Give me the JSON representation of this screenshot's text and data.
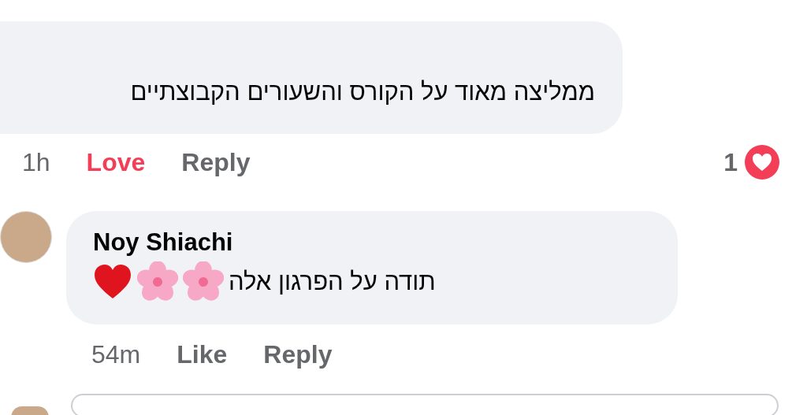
{
  "comments": [
    {
      "kind": "comment",
      "text": "ממליצה מאוד על הקורס והשעורים הקבוצתיים",
      "actions": [
        {
          "label": "1h",
          "kind": "time"
        },
        {
          "label": "Love",
          "kind": "reaction",
          "selected": true
        },
        {
          "label": "Reply",
          "kind": "reply"
        }
      ],
      "reaction_count": "1"
    },
    {
      "kind": "reply",
      "author": "Noy Shiachi",
      "text": "תודה על הפרגון אלה",
      "actions": [
        {
          "label": "54m",
          "kind": "time"
        },
        {
          "label": "Like",
          "kind": "reaction",
          "selected": false
        },
        {
          "label": "Reply",
          "kind": "reply"
        }
      ]
    }
  ]
}
